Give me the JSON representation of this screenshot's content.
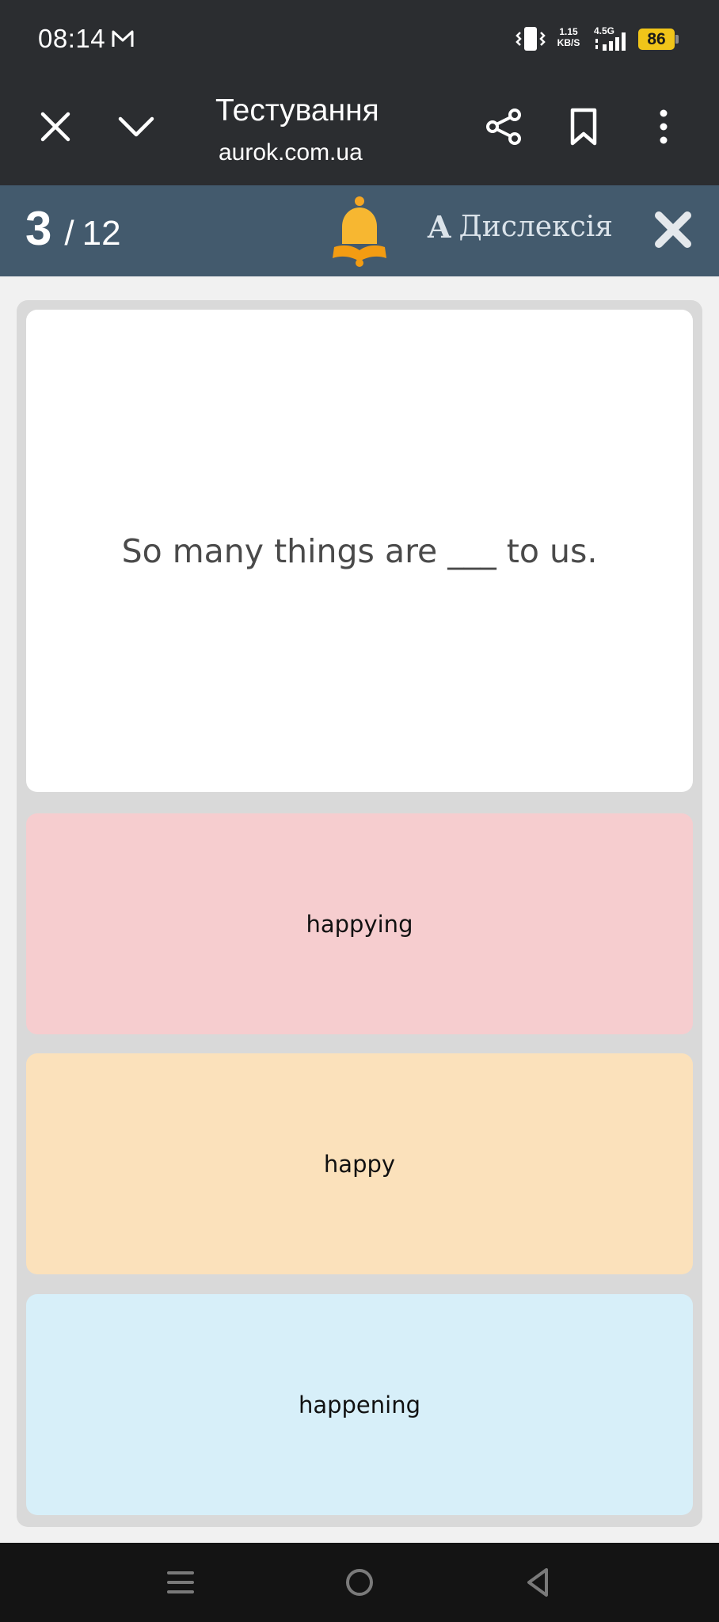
{
  "status_bar": {
    "time": "08:14",
    "net_speed_value": "1.15",
    "net_speed_unit": "KB/S",
    "network_type": "4.5G",
    "battery": "86",
    "icons": [
      "mail-icon",
      "vibrate-icon",
      "signal-icon",
      "battery-icon"
    ]
  },
  "browser": {
    "title": "Тестування",
    "url": "aurok.com.ua",
    "icons": [
      "close-icon",
      "chevron-down-icon",
      "share-icon",
      "bookmark-icon",
      "more-vert-icon"
    ]
  },
  "quiz_header": {
    "current": "3",
    "separator": "/",
    "total": "12",
    "dyslexia_glyph": "A",
    "dyslexia_label": "Дислексія",
    "icons": [
      "bell-icon",
      "close-x-icon"
    ]
  },
  "question": {
    "text": "So many things are ___ to us."
  },
  "answers": [
    {
      "label": "happying",
      "color": "#f6cdcf"
    },
    {
      "label": "happy",
      "color": "#fbe1bb"
    },
    {
      "label": "happening",
      "color": "#d7eff9"
    }
  ],
  "colors": {
    "system_bar": "#2b2d30",
    "quiz_header": "#435a6d",
    "bell": "#f5a623",
    "battery": "#f0c419"
  },
  "nav_bar": {
    "icons": [
      "menu-icon",
      "home-circle-icon",
      "back-triangle-icon"
    ]
  }
}
